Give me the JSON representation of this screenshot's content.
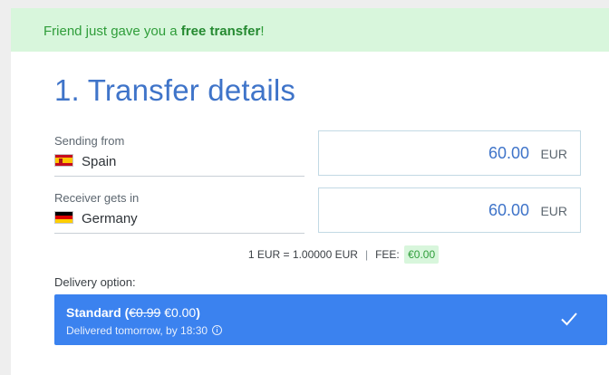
{
  "banner": {
    "text_before": "Friend just gave you a ",
    "text_bold": "free transfer",
    "text_after": "!"
  },
  "page_title": "1. Transfer details",
  "sending": {
    "label": "Sending from",
    "country": "Spain",
    "flag_icon": "spain-flag-icon",
    "amount": "60.00",
    "currency": "EUR"
  },
  "receiving": {
    "label": "Receiver gets in",
    "country": "Germany",
    "flag_icon": "germany-flag-icon",
    "amount": "60.00",
    "currency": "EUR"
  },
  "rate": {
    "text": "1 EUR = 1.00000 EUR",
    "separator": "|",
    "fee_label": "FEE:",
    "fee_value": "€0.00"
  },
  "delivery": {
    "label": "Delivery option:",
    "option": {
      "name": "Standard",
      "old_price": "€0.99",
      "new_price": "€0.00",
      "subtitle": "Delivered tomorrow, by 18:30",
      "selected": true
    }
  },
  "colors": {
    "accent": "#3b82ef",
    "title": "#3f74c9",
    "banner_bg": "#d8f6dc",
    "banner_text": "#2f9d3a"
  }
}
